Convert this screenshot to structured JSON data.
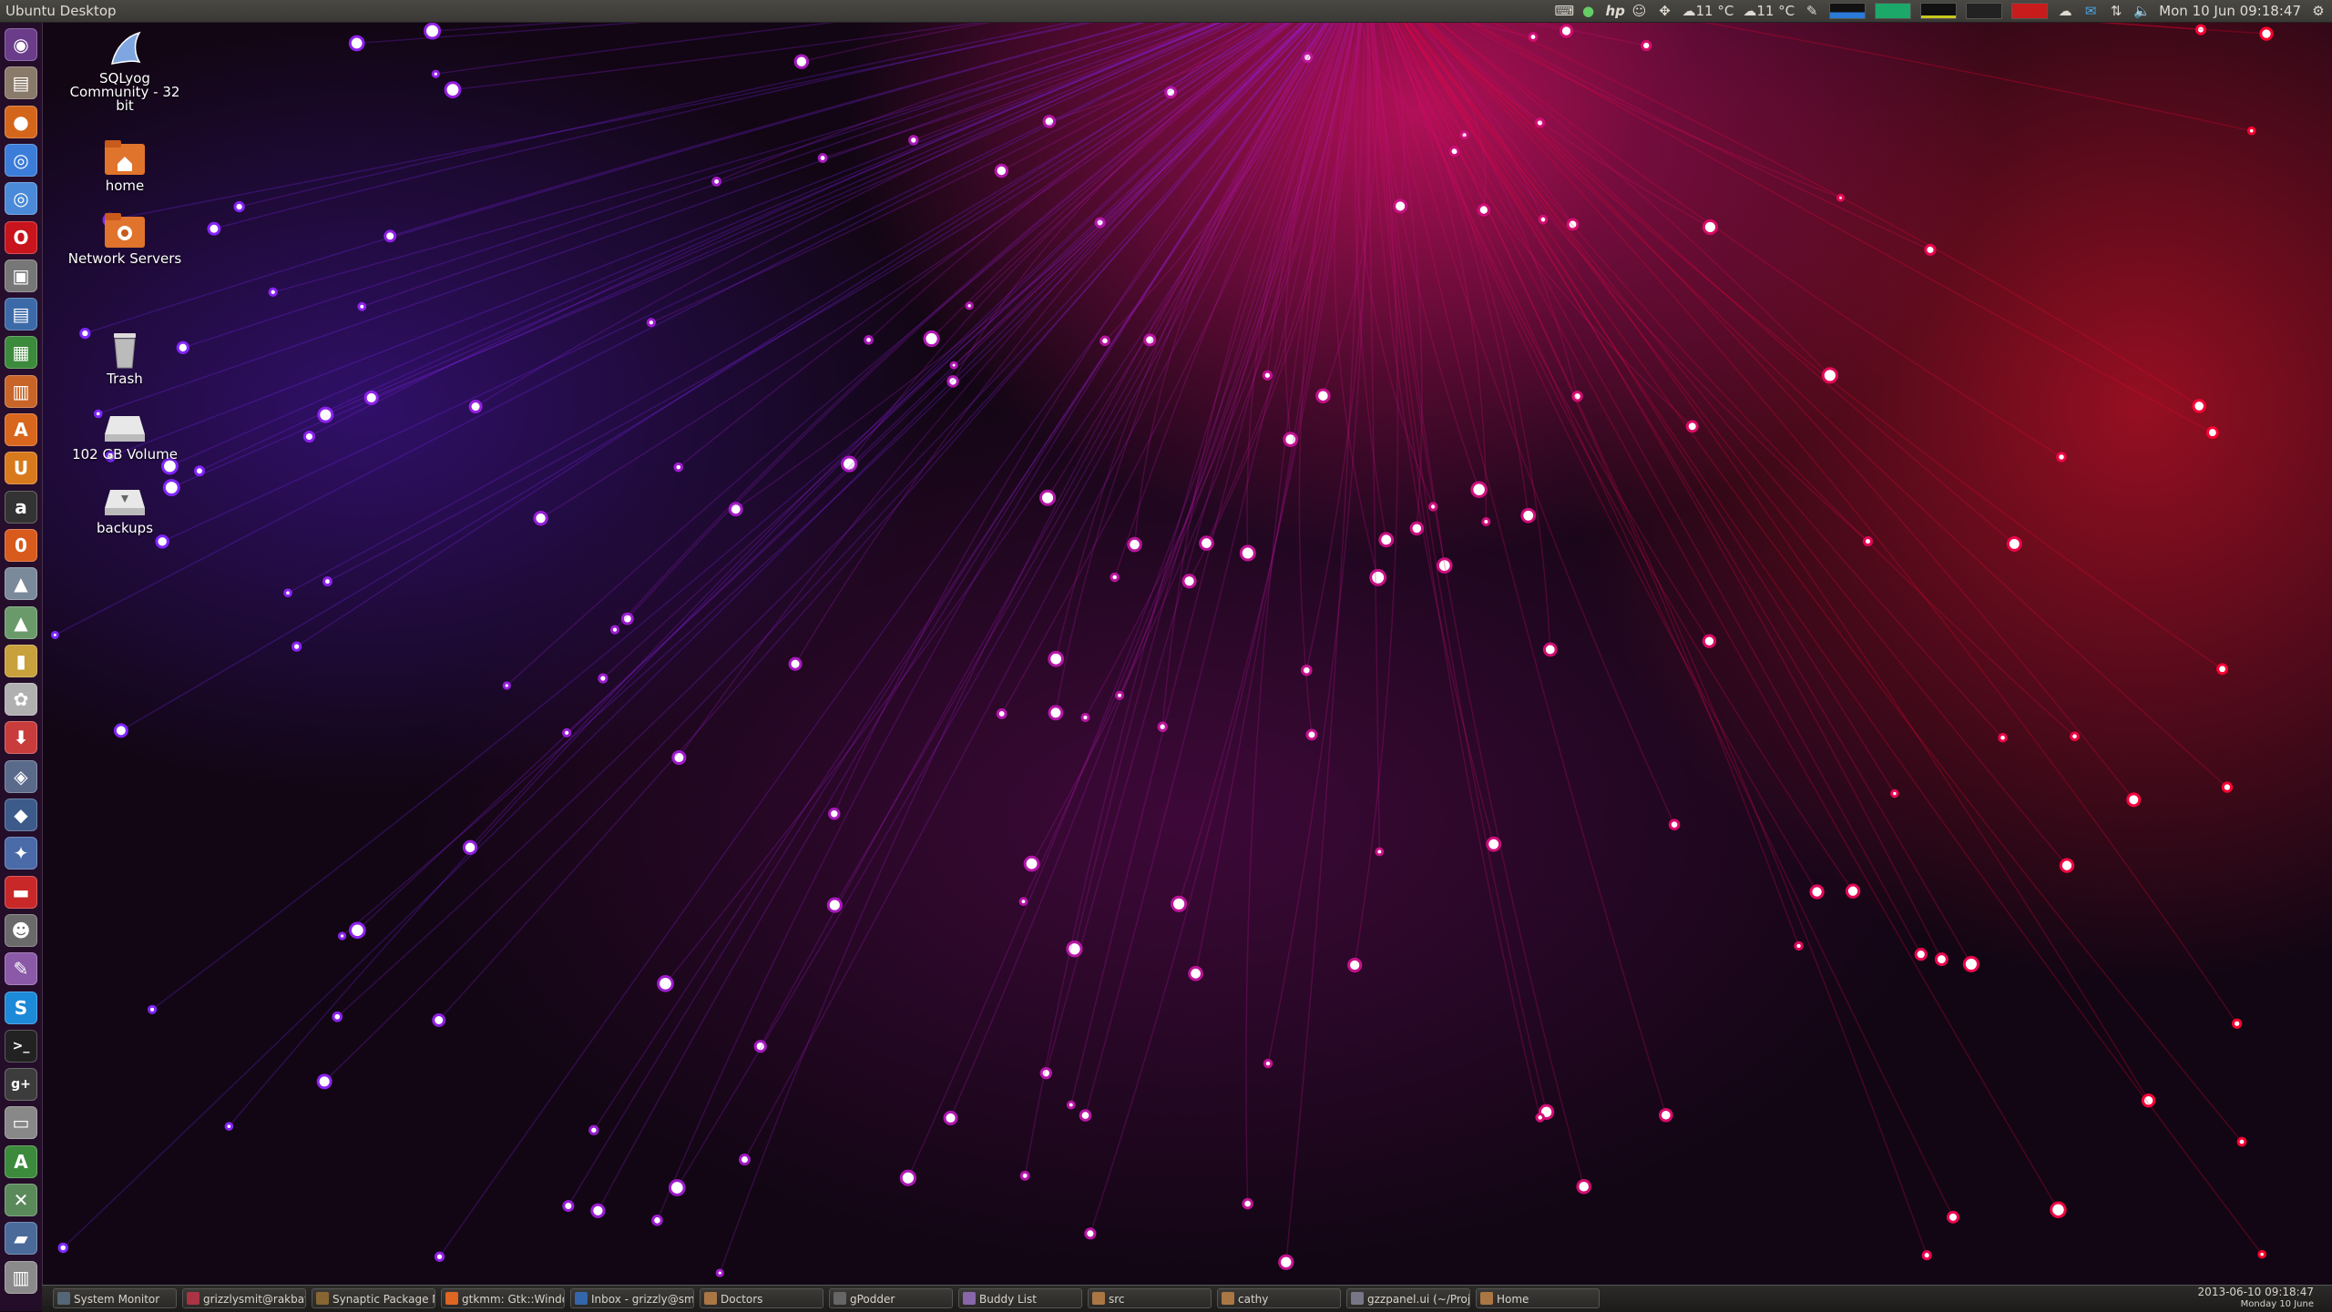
{
  "top_panel": {
    "title": "Ubuntu Desktop",
    "weather1": "11 °C",
    "weather2": "11 °C",
    "datetime": "Mon 10 Jun  09:18:47",
    "icons": [
      "keyboard-icon",
      "update-icon",
      "hp-icon",
      "user-icon",
      "dropbox-icon",
      "weather-icon",
      "weather-icon",
      "clip-icon",
      "sysmon-graph",
      "cloud-icon",
      "mail-icon",
      "network-icon",
      "volume-icon",
      "gear-icon"
    ]
  },
  "desktop_icons": [
    {
      "name": "sqlyog-icon",
      "label": "SQLyog Community - 32 bit"
    },
    {
      "name": "home-folder-icon",
      "label": "home"
    },
    {
      "name": "network-servers-icon",
      "label": "Network Servers"
    },
    {
      "name": "trash-icon",
      "label": "Trash"
    },
    {
      "name": "volume-icon",
      "label": "102 GB Volume"
    },
    {
      "name": "backups-icon",
      "label": "backups"
    }
  ],
  "launcher": [
    {
      "name": "dash-home-icon",
      "color": "#6a3c8a",
      "glyph": "◉"
    },
    {
      "name": "files-icon",
      "color": "#8a7a6a",
      "glyph": "▤"
    },
    {
      "name": "firefox-icon",
      "color": "#d4661c",
      "glyph": "●"
    },
    {
      "name": "chrome-icon",
      "color": "#3b7dd8",
      "glyph": "◎"
    },
    {
      "name": "chromium-icon",
      "color": "#4a8ad8",
      "glyph": "◎"
    },
    {
      "name": "opera-icon",
      "color": "#c8141c",
      "glyph": "O"
    },
    {
      "name": "sd-card-icon",
      "color": "#777777",
      "glyph": "▣"
    },
    {
      "name": "writer-icon",
      "color": "#3c6aa8",
      "glyph": "▤"
    },
    {
      "name": "calc-icon",
      "color": "#3c8a3c",
      "glyph": "▦"
    },
    {
      "name": "impress-icon",
      "color": "#c86428",
      "glyph": "▥"
    },
    {
      "name": "software-center-icon",
      "color": "#d8661c",
      "glyph": "A"
    },
    {
      "name": "ubuntu-one-icon",
      "color": "#d87a1c",
      "glyph": "U"
    },
    {
      "name": "amazon-icon",
      "color": "#333333",
      "glyph": "a"
    },
    {
      "name": "ubuntu-one-music-icon",
      "color": "#d85a1c",
      "glyph": "0"
    },
    {
      "name": "app-icon-1",
      "color": "#7a8a9a",
      "glyph": "▲"
    },
    {
      "name": "app-icon-2",
      "color": "#6a9a6a",
      "glyph": "▲"
    },
    {
      "name": "archive-icon",
      "color": "#c8a03c",
      "glyph": "▮"
    },
    {
      "name": "settings-icon",
      "color": "#b0b0b0",
      "glyph": "✿"
    },
    {
      "name": "installer-icon",
      "color": "#c83c3c",
      "glyph": "⬇"
    },
    {
      "name": "network-app-icon",
      "color": "#5a6a8a",
      "glyph": "◈"
    },
    {
      "name": "postgres-icon",
      "color": "#3c5a8a",
      "glyph": "◆"
    },
    {
      "name": "sqlyog-launcher-icon",
      "color": "#4a6aa8",
      "glyph": "✦"
    },
    {
      "name": "presentation-icon",
      "color": "#c82828",
      "glyph": "▬"
    },
    {
      "name": "gnome-icon",
      "color": "#6a6a6a",
      "glyph": "☻"
    },
    {
      "name": "editor-icon",
      "color": "#8a5aa8",
      "glyph": "✎"
    },
    {
      "name": "skype-icon",
      "color": "#1c8ad8",
      "glyph": "S"
    },
    {
      "name": "terminal-icon",
      "color": "#222222",
      "glyph": ">_"
    },
    {
      "name": "google-plus-icon",
      "color": "#3c3c3c",
      "glyph": "g+"
    },
    {
      "name": "panel-icon",
      "color": "#888888",
      "glyph": "▭"
    },
    {
      "name": "android-icon",
      "color": "#3c8a3c",
      "glyph": "A"
    },
    {
      "name": "tools-icon",
      "color": "#5a8a5a",
      "glyph": "✕"
    },
    {
      "name": "workspace-icon",
      "color": "#4a6a9a",
      "glyph": "▰"
    },
    {
      "name": "trash-launcher-icon",
      "color": "#8a8a8a",
      "glyph": "▥"
    }
  ],
  "taskbar": [
    {
      "label": "System Monitor",
      "color": "#556677"
    },
    {
      "label": "grizzlysmit@rakbat: ...",
      "color": "#aa3344"
    },
    {
      "label": "Synaptic Package M...",
      "color": "#886633"
    },
    {
      "label": "gtkmm: Gtk::Window...",
      "color": "#dd6622"
    },
    {
      "label": "Inbox - grizzly@smit...",
      "color": "#3366aa"
    },
    {
      "label": "Doctors",
      "color": "#aa7744"
    },
    {
      "label": "gPodder",
      "color": "#666666"
    },
    {
      "label": "Buddy List",
      "color": "#8866aa"
    },
    {
      "label": "src",
      "color": "#aa7744"
    },
    {
      "label": "cathy",
      "color": "#aa7744"
    },
    {
      "label": "gzzpanel.ui (~/Proje...",
      "color": "#777788"
    },
    {
      "label": "Home",
      "color": "#aa7744"
    }
  ],
  "bottom_clock": {
    "line1": "2013-06-10 09:18:47",
    "line2": "Monday 10 June"
  }
}
